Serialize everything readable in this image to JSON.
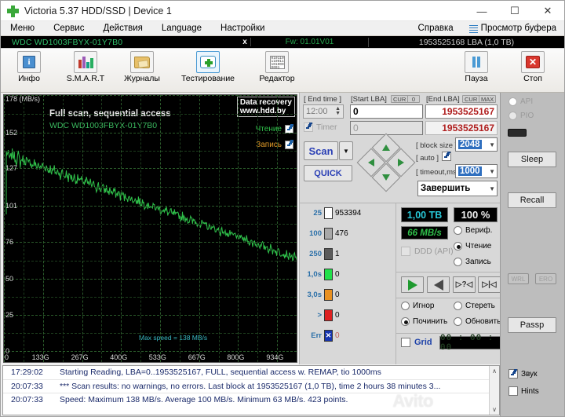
{
  "window": {
    "title": "Victoria 5.37 HDD/SSD | Device 1",
    "icon": "green-cross-icon",
    "minimize": "—",
    "maximize": "☐",
    "close": "✕"
  },
  "menubar": {
    "items": [
      "Меню",
      "Сервис",
      "Действия",
      "Language",
      "Настройки"
    ],
    "help": "Справка",
    "buffer_view": "Просмотр буфера"
  },
  "drivebar": {
    "model": "WDC WD1003FBYX-01Y7B0",
    "close_x": "x",
    "firmware": "Fw: 01.01V01",
    "capacity": "1953525168 LBA (1,0 TB)"
  },
  "toolbar": {
    "items": [
      {
        "label": "Инфо",
        "icon": "info-icon"
      },
      {
        "label": "S.M.A.R.T",
        "icon": "smart-bars-icon"
      },
      {
        "label": "Журналы",
        "icon": "folder-icon"
      },
      {
        "label": "Тестирование",
        "icon": "test-cross-icon"
      },
      {
        "label": "Редактор",
        "icon": "hex-editor-icon"
      }
    ],
    "pause": {
      "label": "Пауза",
      "icon": "pause-icon"
    },
    "stop": {
      "label": "Стоп",
      "icon": "stop-x-icon"
    },
    "editor_glyph": "010110\n110011\n101000\n0001"
  },
  "chart_data": {
    "type": "line",
    "title": "Full scan, sequential access",
    "subtitle": "WDC WD1003FBYX-01Y7B0",
    "ylabel": "178 (MB/s)",
    "xlabel": "",
    "ylim": [
      0,
      178
    ],
    "xlim": [
      0,
      1000
    ],
    "yticks": [
      "178 (MB/s)",
      "152",
      "127",
      "101",
      "76",
      "50",
      "25",
      "0"
    ],
    "ytick_values": [
      178,
      152,
      127,
      101,
      76,
      50,
      25,
      0
    ],
    "xticks": [
      "0",
      "133G",
      "267G",
      "400G",
      "533G",
      "667G",
      "800G",
      "934G"
    ],
    "xtick_values": [
      0,
      133,
      267,
      400,
      533,
      667,
      800,
      934
    ],
    "annotation": "Max speed = 138 MB/s",
    "grid": true,
    "legend_position": "top-right",
    "legend": [
      {
        "label": "Чтение",
        "color": "#2fc04a",
        "checked": true
      },
      {
        "label": "Запись",
        "color": "#e09a28",
        "checked": true
      }
    ],
    "watermark": [
      "Data recovery",
      "www.hdd.by"
    ],
    "series": [
      {
        "name": "Чтение",
        "color": "#2fc04a",
        "values": [
          138,
          136,
          133,
          137,
          135,
          132,
          136,
          130,
          134,
          131,
          133,
          129,
          132,
          128,
          131,
          127,
          130,
          126,
          129,
          127,
          128,
          125,
          127,
          124,
          126,
          123,
          125,
          122,
          124,
          121,
          123,
          120,
          122,
          119,
          121,
          118,
          120,
          117,
          119,
          116,
          118,
          115,
          117,
          114,
          116,
          113,
          115,
          112,
          114,
          111,
          113,
          110,
          112,
          109,
          111,
          108,
          110,
          107,
          109,
          106,
          108,
          105,
          107,
          104,
          106,
          103,
          105,
          102,
          104,
          101,
          103,
          100,
          102,
          99,
          101,
          98,
          100,
          97,
          99,
          96,
          98,
          95,
          97,
          94,
          96,
          93,
          95,
          92,
          94,
          91,
          93,
          90,
          92,
          89,
          91,
          88,
          90,
          87,
          89,
          86,
          88,
          85,
          87,
          84,
          86,
          83,
          85,
          82,
          84,
          81,
          83,
          80,
          82,
          79,
          81,
          78,
          80,
          77,
          79,
          76,
          78,
          75,
          77,
          74,
          76,
          73,
          75,
          72,
          74,
          71,
          73,
          70,
          72,
          69,
          71,
          68,
          70,
          67,
          69,
          66,
          68,
          65,
          67,
          64,
          66,
          63
        ]
      }
    ],
    "stats": {
      "maximum": 138,
      "average": 100,
      "minimum": 63,
      "points": 423
    }
  },
  "controls": {
    "end_time": {
      "label": "[ End time ]",
      "value": "12:00"
    },
    "timer": {
      "label": "Timer",
      "checked": true,
      "enabled": false
    },
    "start_lba": {
      "label": "[Start LBA]",
      "badge_cur": "CUR",
      "badge_val": "0",
      "value": "0",
      "value2": "0"
    },
    "end_lba": {
      "label": "[End LBA]",
      "badge_cur": "CUR",
      "badge_max": "MAX",
      "value": "1953525167",
      "value2": "1953525167"
    },
    "scan_button": "Scan",
    "quick_button": "QUICK",
    "dpad": [
      "up-arrow-icon",
      "down-arrow-icon",
      "left-arrow-icon",
      "right-arrow-icon"
    ],
    "block_size": {
      "label": "[ block size ]",
      "value": "2048"
    },
    "auto": {
      "label": "[ auto ]",
      "checked": true
    },
    "timeout": {
      "label": "[ timeout,ms ]",
      "value": "1000"
    },
    "finish_combo": "Завершить"
  },
  "blockstats": [
    {
      "threshold": "25",
      "color": "#ffffff",
      "count": "953394"
    },
    {
      "threshold": "100",
      "color": "#a8a8a8",
      "count": "476"
    },
    {
      "threshold": "250",
      "color": "#5a5a5a",
      "count": "1"
    },
    {
      "threshold": "1,0s",
      "color": "#21e04a",
      "count": "0"
    },
    {
      "threshold": "3,0s",
      "color": "#e89020",
      "count": "0"
    },
    {
      "threshold": ">",
      "color": "#dd2020",
      "count": "0"
    },
    {
      "threshold": "Err",
      "color": "#1634b0",
      "count": "0"
    }
  ],
  "readout": {
    "capacity": "1,00 TB",
    "percent": "100   %",
    "speed": "66 MB/s",
    "ddd_api": {
      "label": "DDD (API)",
      "checked": false
    },
    "modes": [
      {
        "label": "Вериф.",
        "selected": false
      },
      {
        "label": "Чтение",
        "selected": true
      },
      {
        "label": "Запись",
        "selected": false
      }
    ],
    "nav_buttons": [
      "play-icon",
      "rewind-icon",
      "skip-query-icon",
      "skip-end-icon"
    ],
    "actions": [
      {
        "label": "Игнор",
        "selected": false
      },
      {
        "label": "Стереть",
        "selected": false
      },
      {
        "label": "Починить",
        "selected": true
      },
      {
        "label": "Обновить",
        "selected": false
      }
    ],
    "grid": {
      "label": "Grid",
      "checked": false
    },
    "timer_display": "00 : 00 : 00"
  },
  "rightpanel": {
    "api": {
      "label": "API",
      "selected": true
    },
    "pio": {
      "label": "PIO",
      "selected": false
    },
    "sleep": "Sleep",
    "recall": "Recall",
    "wrl": "WRL",
    "ero": "ERO",
    "passp": "Passp"
  },
  "log": {
    "lines": [
      {
        "time": "17:29:02",
        "message": "Starting Reading, LBA=0..1953525167, FULL, sequential access w. REMAP, tio 1000ms"
      },
      {
        "time": "20:07:33",
        "message": "*** Scan results: no warnings, no errors. Last block at 1953525167 (1,0 TB), time 2 hours 38 minutes 3..."
      },
      {
        "time": "20:07:33",
        "message": "Speed: Maximum 138 MB/s. Average 100 MB/s. Minimum 63 MB/s. 423 points."
      }
    ],
    "scroll_up": "∧",
    "scroll_down": "∨",
    "sound": {
      "label": "Звук",
      "checked": true
    },
    "hints": {
      "label": "Hints",
      "checked": false
    },
    "watermark": "Avito"
  }
}
